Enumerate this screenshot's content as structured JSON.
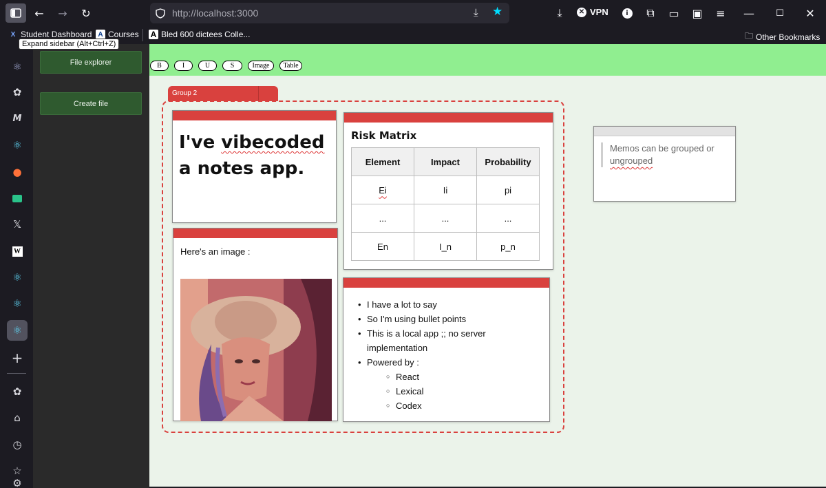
{
  "browser": {
    "url_host": "http://localhost",
    "url_port": ":3000",
    "vpn_label": "VPN",
    "tooltip": "Expand sidebar (Alt+Ctrl+Z)"
  },
  "bookmarks": {
    "items": [
      "Student Dashboard",
      "Courses",
      "Bled 600 dictees Colle..."
    ],
    "other": "Other Bookmarks"
  },
  "panel": {
    "file_explorer": "File explorer",
    "create_file": "Create file"
  },
  "toolbar": {
    "bold": "B",
    "italic": "I",
    "underline": "U",
    "strike": "S",
    "image": "Image",
    "table": "Table"
  },
  "group": {
    "label": "Group 2"
  },
  "note_title": {
    "line_a": "I've ",
    "line_b": "vibecoded",
    "line_c": "a notes app."
  },
  "risk": {
    "title": "Risk Matrix",
    "headers": [
      "Element",
      "Impact",
      "Probability"
    ],
    "rows": [
      [
        "Ei",
        "Ii",
        "pi"
      ],
      [
        "...",
        "...",
        "..."
      ],
      [
        "En",
        "I_n",
        "p_n"
      ]
    ]
  },
  "image_note": {
    "caption": "Here's an image :"
  },
  "bullets": {
    "items": [
      "I have a lot to say",
      "So I'm using bullet points",
      "This is a local app ;; no server implementation",
      "Powered by :"
    ],
    "sub": [
      "React",
      "Lexical",
      "Codex"
    ]
  },
  "memo": {
    "text_a": "Memos can be grouped or ",
    "text_b": "ungrouped"
  },
  "colors": {
    "accent": "#d9413e",
    "toolbar": "#90ee90",
    "canvas": "#ebf3ea"
  }
}
